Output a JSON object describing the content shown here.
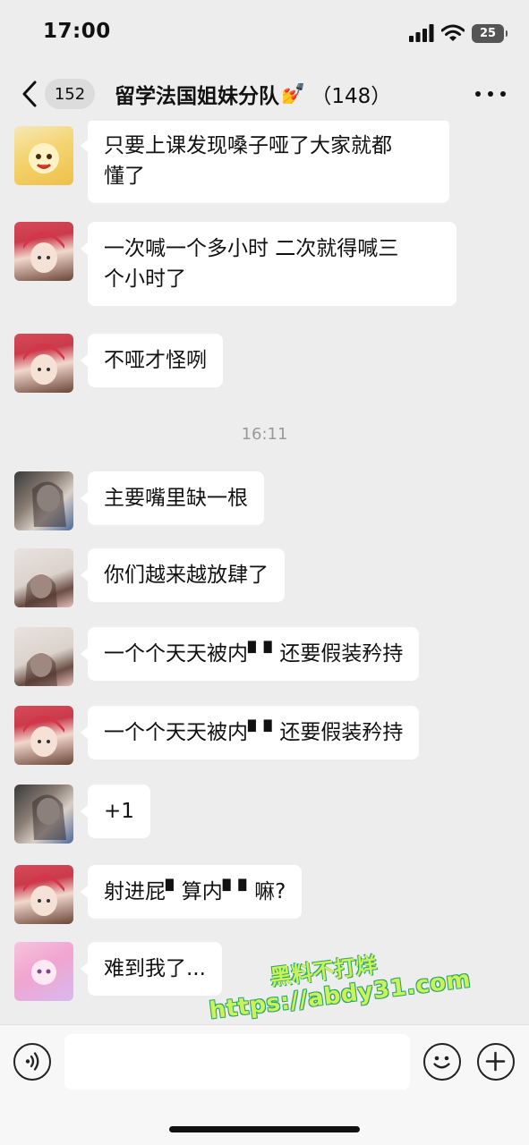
{
  "status_bar": {
    "time": "17:00",
    "battery": "25"
  },
  "nav": {
    "unread_count": "152",
    "title": "留学法国姐妹分队",
    "title_emoji": "💅",
    "member_count": "（148）"
  },
  "messages": [
    {
      "avatar": "yellow",
      "text": "只要上课发现嗓子哑了大家就都\n懂了"
    },
    {
      "avatar": "red",
      "text": "一次喊一个多小时 二次就得喊三\n个小时了"
    },
    {
      "avatar": "red",
      "text": "不哑才怪咧"
    },
    {
      "avatar": "dark",
      "text": "主要嘴里缺一根"
    },
    {
      "avatar": "light",
      "text": "你们越来越放肆了"
    },
    {
      "avatar": "light",
      "text": "一个个天天被内▘▘还要假装矜持"
    },
    {
      "avatar": "red",
      "text": "一个个天天被内▘▘还要假装矜持"
    },
    {
      "avatar": "dark",
      "text": "+1"
    },
    {
      "avatar": "red",
      "text": "射进屁▘算内▘▘嘛?"
    },
    {
      "avatar": "pink",
      "text": "难到我了..."
    }
  ],
  "time_separator": "16:11",
  "watermark": {
    "line1": "黑料不打烊",
    "line2": "https://abdy31.com"
  },
  "icons": {
    "back": "chevron-left-icon",
    "more": "more-dots-icon",
    "voice": "voice-icon",
    "emoji": "emoji-icon",
    "plus": "plus-icon"
  }
}
